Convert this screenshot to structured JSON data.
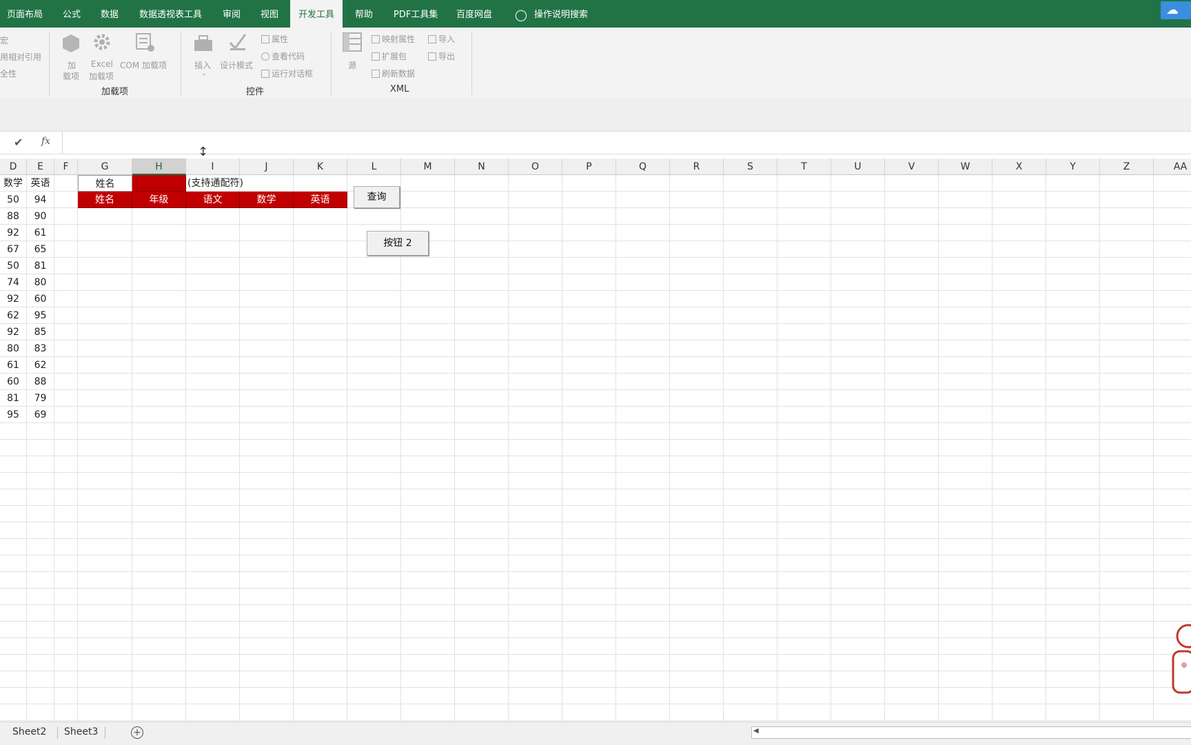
{
  "tabs": [
    "页面布局",
    "公式",
    "数据",
    "数据透视表工具",
    "审阅",
    "视图",
    "开发工具",
    "帮助",
    "PDF工具集",
    "百度网盘"
  ],
  "active_tab": "开发工具",
  "tell_me": "操作说明搜索",
  "ribbon": {
    "code_partial": [
      "宏",
      "用相对引用",
      "全性"
    ],
    "addins": {
      "btn1_line1": "加",
      "btn1_line2": "载项",
      "btn2_line1": "Excel",
      "btn2_line2": "加载项",
      "btn3": "COM 加载项",
      "label": "加载项"
    },
    "controls": {
      "insert": "插入",
      "design_mode": "设计模式",
      "properties": "属性",
      "view_code": "查看代码",
      "run_dialog": "运行对话框",
      "label": "控件"
    },
    "xml": {
      "source": "源",
      "map_props": "映射属性",
      "expansion": "扩展包",
      "refresh": "刷新数据",
      "import": "导入",
      "export": "导出",
      "label": "XML"
    }
  },
  "formula_bar": {
    "check": "✔",
    "fx": "fx"
  },
  "columns": [
    "D",
    "E",
    "F",
    "G",
    "H",
    "I",
    "J",
    "K",
    "L",
    "M",
    "N",
    "O",
    "P",
    "Q",
    "R",
    "S",
    "T",
    "U",
    "V",
    "W",
    "X",
    "Y",
    "Z",
    "AA"
  ],
  "selected_column": "H",
  "data_header": [
    "数学",
    "英语"
  ],
  "data_rows": [
    [
      "50",
      "94"
    ],
    [
      "88",
      "90"
    ],
    [
      "92",
      "61"
    ],
    [
      "67",
      "65"
    ],
    [
      "50",
      "81"
    ],
    [
      "74",
      "80"
    ],
    [
      "92",
      "60"
    ],
    [
      "62",
      "95"
    ],
    [
      "92",
      "85"
    ],
    [
      "80",
      "83"
    ],
    [
      "61",
      "62"
    ],
    [
      "60",
      "88"
    ],
    [
      "81",
      "79"
    ],
    [
      "95",
      "69"
    ]
  ],
  "query": {
    "label": "姓名",
    "hint": "(支持通配符)",
    "headers": [
      "姓名",
      "年级",
      "语文",
      "数学",
      "英语"
    ]
  },
  "buttons": {
    "query": "查询",
    "button2": "按钮 2"
  },
  "sheets": [
    "Sheet2",
    "Sheet3"
  ],
  "add_sheet": "+",
  "colors": {
    "excel_green": "#217346",
    "header_red": "#c00000"
  }
}
